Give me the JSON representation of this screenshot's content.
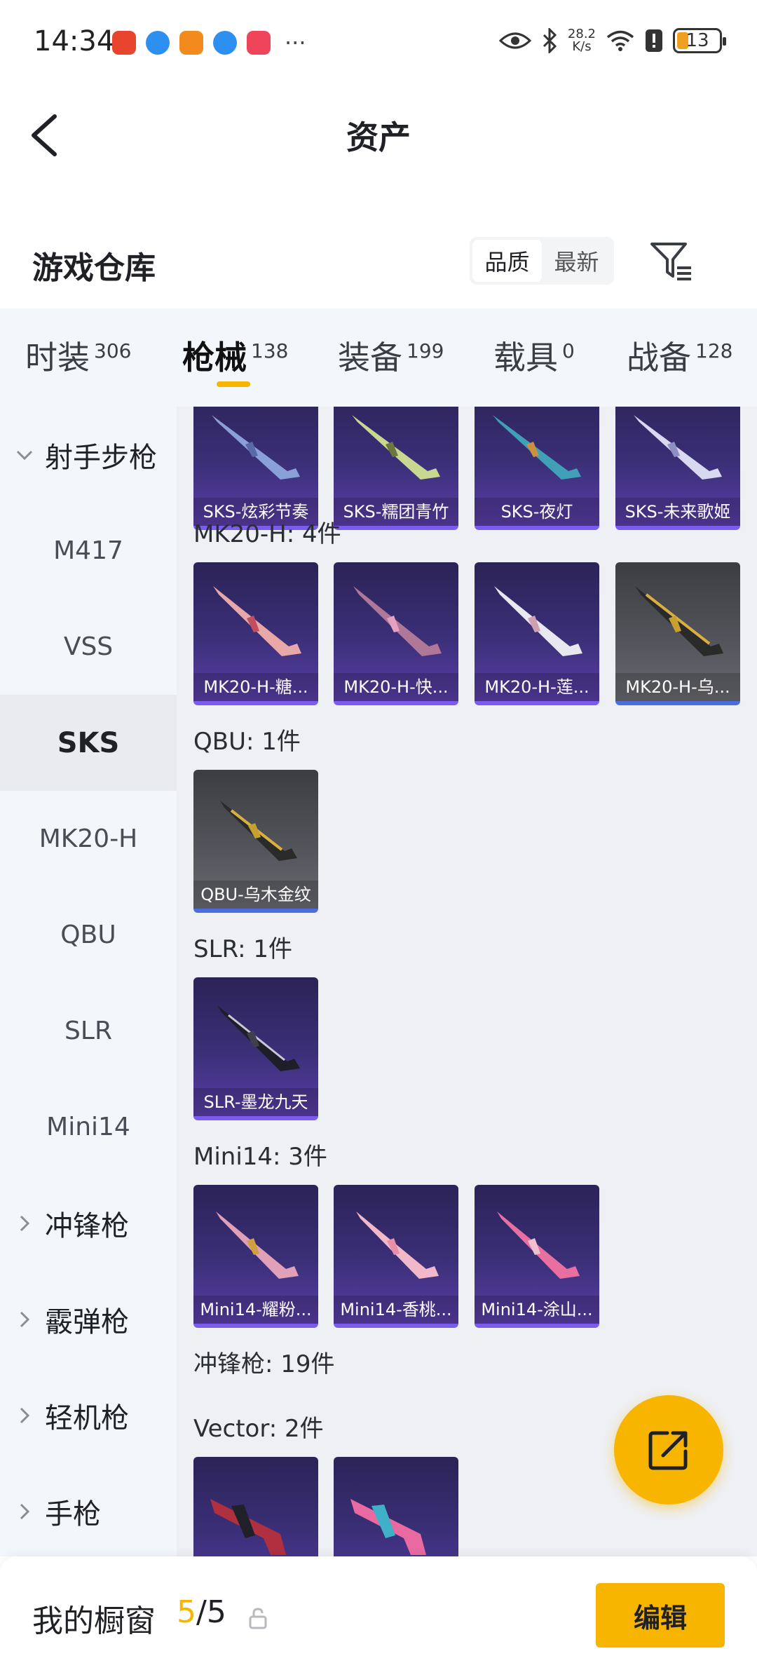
{
  "status_bar": {
    "time": "14:34",
    "more": "···",
    "net_speed_value": "28.2",
    "net_speed_unit": "K/s",
    "battery": "13"
  },
  "header": {
    "title": "资产"
  },
  "warehouse": {
    "title": "游戏仓库",
    "sort_options": [
      "品质",
      "最新"
    ],
    "active_sort": "品质"
  },
  "category_tabs": [
    {
      "label": "时装",
      "count": "306"
    },
    {
      "label": "枪械",
      "count": "138",
      "active": true
    },
    {
      "label": "装备",
      "count": "199"
    },
    {
      "label": "载具",
      "count": "0"
    },
    {
      "label": "战备",
      "count": "128"
    }
  ],
  "sidebar": {
    "group_open": "射手步枪",
    "items": [
      "M417",
      "VSS",
      "SKS",
      "MK20-H",
      "QBU",
      "SLR",
      "Mini14"
    ],
    "active_item": "SKS",
    "groups_collapsed": [
      "冲锋枪",
      "霰弹枪",
      "轻机枪",
      "手枪"
    ]
  },
  "content": {
    "sks_cards": [
      "SKS-炫彩节奏",
      "SKS-糯团青竹",
      "SKS-夜灯",
      "SKS-未来歌姬"
    ],
    "mk20_label": "MK20-H: 4件",
    "mk20_cards": [
      "MK20-H-糖...",
      "MK20-H-快...",
      "MK20-H-莲...",
      "MK20-H-乌..."
    ],
    "qbu_label": "QBU: 1件",
    "qbu_cards": [
      "QBU-乌木金纹"
    ],
    "slr_label": "SLR: 1件",
    "slr_cards": [
      "SLR-墨龙九天"
    ],
    "mini14_label": "Mini14: 3件",
    "mini14_cards": [
      "Mini14-耀粉...",
      "Mini14-香桃...",
      "Mini14-涂山..."
    ],
    "smg_label": "冲锋枪: 19件",
    "vector_label": "Vector: 2件"
  },
  "showcase": {
    "label": "我的橱窗",
    "current": "5",
    "total": "/5",
    "edit_label": "编辑"
  },
  "colors": {
    "accent": "#f7b500",
    "card_purple": "#3b2f78",
    "card_gray": "#55565d",
    "sidebar_bg": "#f3f7fc",
    "content_bg": "#eef0f4"
  }
}
